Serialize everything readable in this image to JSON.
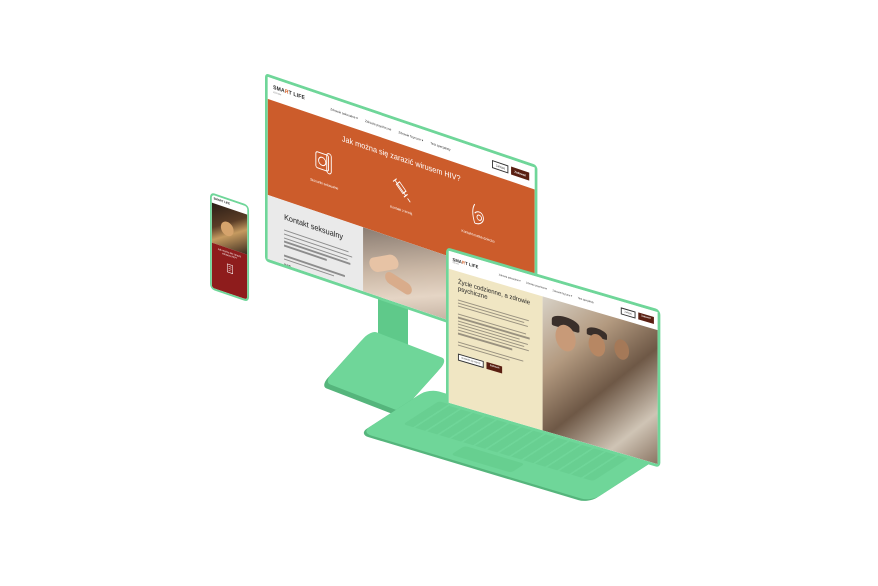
{
  "monitor": {
    "logo": {
      "prefix": "SMA",
      "accent": "R",
      "suffix": "T LIFE",
      "sub": "Zdrowie"
    },
    "nav": [
      "Zdrowie seksualne ▾",
      "Zdrowie psychiczne",
      "Zdrowie fizyczne ▾",
      "Test specjalisty"
    ],
    "buttons": {
      "outline": "Zaloguj",
      "dark": "Zadzwoń"
    },
    "hero_title": "Jak można się zarazić wirusem HIV?",
    "hero_items": [
      "Stosunki seksualne",
      "Kontakt z krwią",
      "Kontakt matka-dziecko"
    ],
    "section_title": "Kontakt seksualny",
    "section_highlight": "PrEP"
  },
  "phone": {
    "logo": "SMART LIFE",
    "red_text": "Jak można się zarazić wirusem HIV?"
  },
  "laptop": {
    "logo": {
      "prefix": "SMA",
      "accent": "R",
      "suffix": "T LIFE",
      "sub": "Zdrowie"
    },
    "nav": [
      "Zdrowie seksualne ▾",
      "Zdrowie psychiczne",
      "Zdrowie fizyczne ▾",
      "Test specjalisty"
    ],
    "buttons": {
      "outline": "Zaloguj",
      "dark": "Zadzwoń"
    },
    "title": "Życie codzienne, a zdrowie psychiczne",
    "cta": {
      "outline": "Dowiedz się więcej",
      "dark": "Zadzwoń"
    }
  },
  "colors": {
    "device_green": "#6fd699",
    "orange": "#cc5c2b",
    "dark_brown": "#5a1f12",
    "beige": "#f0e6c3",
    "red": "#8e1c1c"
  }
}
